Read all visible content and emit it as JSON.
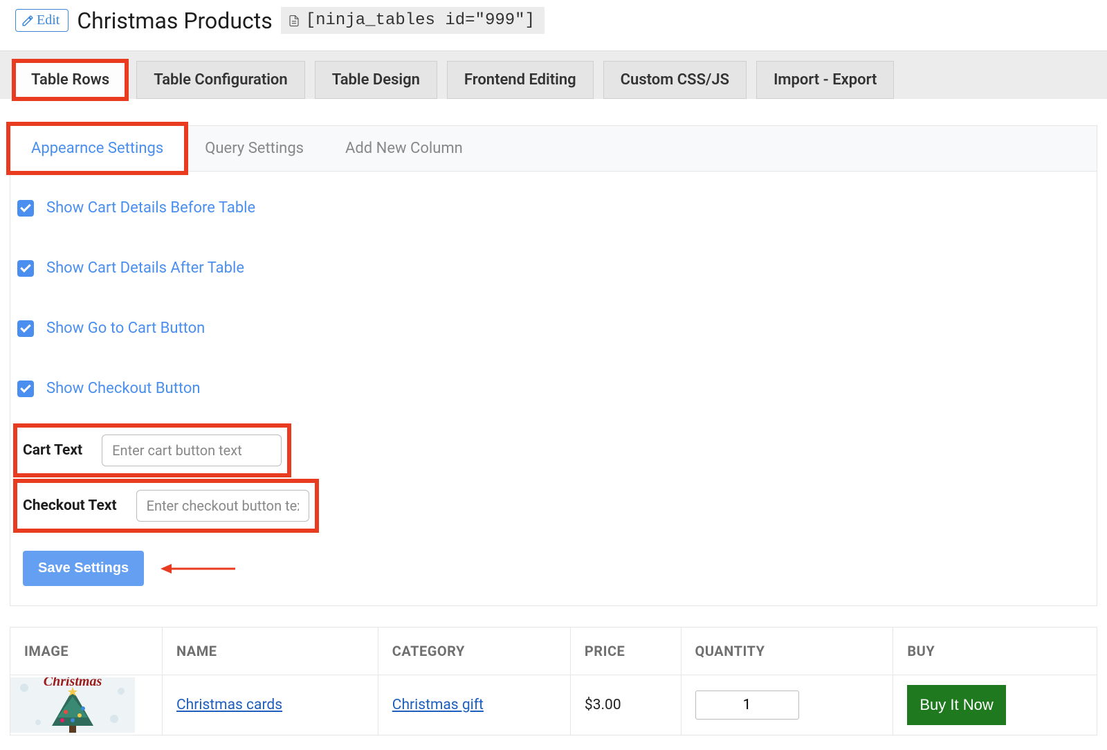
{
  "header": {
    "edit_label": "Edit",
    "title": "Christmas Products",
    "shortcode": "[ninja_tables id=\"999\"]"
  },
  "primary_tabs": [
    {
      "label": "Table Rows",
      "active": true,
      "highlight": true
    },
    {
      "label": "Table Configuration",
      "active": false,
      "highlight": false
    },
    {
      "label": "Table Design",
      "active": false,
      "highlight": false
    },
    {
      "label": "Frontend Editing",
      "active": false,
      "highlight": false
    },
    {
      "label": "Custom CSS/JS",
      "active": false,
      "highlight": false
    },
    {
      "label": "Import - Export",
      "active": false,
      "highlight": false
    }
  ],
  "sub_tabs": [
    {
      "label": "Appearnce Settings",
      "active": true,
      "highlight": true
    },
    {
      "label": "Query Settings",
      "active": false,
      "highlight": false
    },
    {
      "label": "Add New Column",
      "active": false,
      "highlight": false
    }
  ],
  "settings": {
    "checks": [
      "Show Cart Details Before Table",
      "Show Cart Details After Table",
      "Show Go to Cart Button",
      "Show Checkout Button"
    ],
    "cart_text_label": "Cart Text",
    "cart_text_placeholder": "Enter cart button text",
    "checkout_text_label": "Checkout Text",
    "checkout_text_placeholder": "Enter checkout button text",
    "save_label": "Save Settings"
  },
  "table": {
    "headers": [
      "IMAGE",
      "NAME",
      "CATEGORY",
      "PRICE",
      "QUANTITY",
      "BUY"
    ],
    "row": {
      "name": "Christmas cards",
      "category": "Christmas gift",
      "price": "$3.00",
      "qty": "1",
      "buy_label": "Buy It Now"
    }
  },
  "colors": {
    "accent": "#4a8ff0",
    "highlight": "#e83b1f",
    "buy_green": "#1f7a1f"
  }
}
